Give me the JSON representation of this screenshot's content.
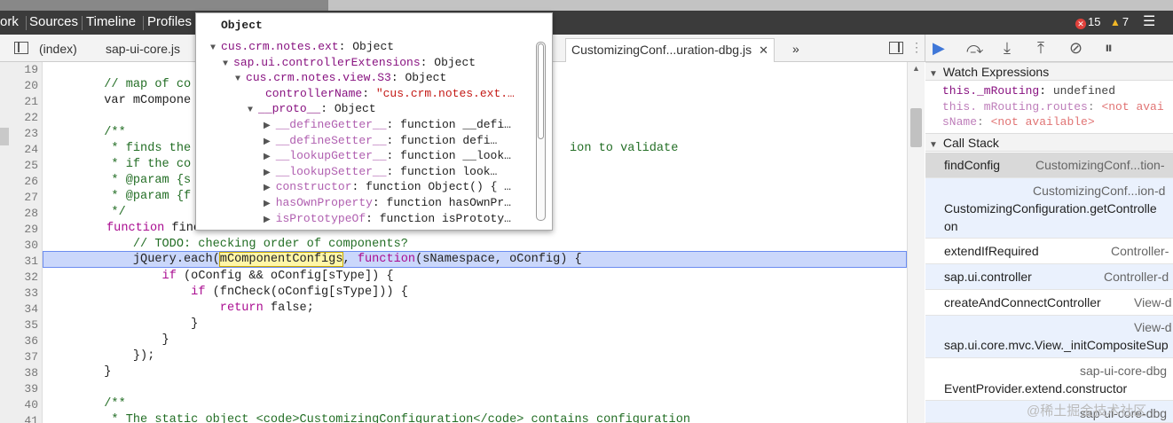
{
  "panel_tabs": [
    "ork",
    "Sources",
    "Timeline",
    "Profiles"
  ],
  "status": {
    "errors": "15",
    "warnings": "7"
  },
  "file_tabs": {
    "items": [
      "(index)",
      "sap-ui-core.js"
    ],
    "active": "CustomizingConf...uration-dbg.js",
    "overflow": "»"
  },
  "popup": {
    "title": "Object",
    "rows": [
      {
        "toggle": "▼",
        "key": "cus.crm.notes.ext",
        "val": "Object"
      },
      {
        "toggle": "▼",
        "key": "sap.ui.controllerExtensions",
        "val": "Object"
      },
      {
        "toggle": "▼",
        "key": "cus.crm.notes.view.S3",
        "val": "Object"
      },
      {
        "toggle": "",
        "key": "controllerName",
        "val": "\"cus.crm.notes.ext.…"
      },
      {
        "toggle": "▼",
        "key": "__proto__",
        "val": "Object"
      },
      {
        "toggle": "▶",
        "key": "__defineGetter__",
        "val": "function __defi…"
      },
      {
        "toggle": "▶",
        "key": "__defineSetter__",
        "val": "function   defi…"
      },
      {
        "toggle": "▶",
        "key": "__lookupGetter__",
        "val": "function __look…"
      },
      {
        "toggle": "▶",
        "key": "__lookupSetter__",
        "val": "function   look…"
      },
      {
        "toggle": "▶",
        "key": "constructor",
        "val": "function Object() { …"
      },
      {
        "toggle": "▶",
        "key": "hasOwnProperty",
        "val": "function hasOwnPr…"
      },
      {
        "toggle": "▶",
        "key": "isPrototypeOf",
        "val": "function isPrototy…"
      }
    ]
  },
  "code": {
    "line_numbers": [
      "19",
      "20",
      "21",
      "22",
      "23",
      "24",
      "25",
      "26",
      "27",
      "28",
      "29",
      "30",
      "31",
      "32",
      "33",
      "34",
      "35",
      "36",
      "37",
      "38",
      "39",
      "40",
      "41"
    ],
    "l20": "        // map of co",
    "l21": "        var mCompone",
    "l23": "        /**",
    "l24a": "         * finds the",
    "l24b": "ion to validate",
    "l25": "         * if the co",
    "l26": "         * @param {s",
    "l27": "         * @param {f",
    "l28": "         */",
    "l29a": "function",
    "l29b": " finc",
    "l29c": "",
    "l30": "            // TODO: checking order of components?",
    "l31a": "            jQuery.each(",
    "l31sel": "mComponentConfigs",
    "l31b": ", ",
    "l31kw": "function",
    "l31c": "(sNamespace, oConfig) {",
    "l32a": "                ",
    "l32kw": "if",
    "l32b": " (oConfig && oConfig[sType]) {",
    "l33a": "                    ",
    "l33kw": "if",
    "l33b": " (fnCheck(oConfig[sType])) {",
    "l34a": "                        ",
    "l34kw": "return",
    "l34b": " false;",
    "l35": "                    }",
    "l36": "                }",
    "l37": "            });",
    "l38": "        }",
    "l40": "        /**",
    "l41": "         * The static object <code>CustomizingConfiguration</code> contains configuration"
  },
  "sections": {
    "watch": "Watch Expressions",
    "callstack": "Call Stack"
  },
  "watch": [
    {
      "key": "this._mRouting",
      "val": "undefined"
    },
    {
      "key": "this. mRouting.routes",
      "val": "<not avai"
    },
    {
      "key": "sName",
      "val": "<not available>"
    }
  ],
  "callstack": [
    {
      "fn": "findConfig",
      "loc": "CustomizingConf...tion-"
    },
    {
      "fn": "CustomizingConfiguration.getControlle",
      "fn2": "on",
      "loc": "CustomizingConf...ion-d"
    },
    {
      "fn": "extendIfRequired",
      "loc": "Controller-"
    },
    {
      "fn": "sap.ui.controller",
      "loc": "Controller-d"
    },
    {
      "fn": "createAndConnectController",
      "loc": "View-d"
    },
    {
      "fn": "sap.ui.core.mvc.View._initCompositeSup",
      "loc": "View-d"
    },
    {
      "fn": "EventProvider.extend.constructor",
      "loc": "sap-ui-core-dbg"
    },
    {
      "fn": "",
      "loc": "sap-ui-core-dbg"
    }
  ],
  "watermark": "@稀土掘金技术社区",
  "colors": {
    "accent": "#3f77d8",
    "highlight": "#cad7fb",
    "selection": "#c9d9f6"
  }
}
